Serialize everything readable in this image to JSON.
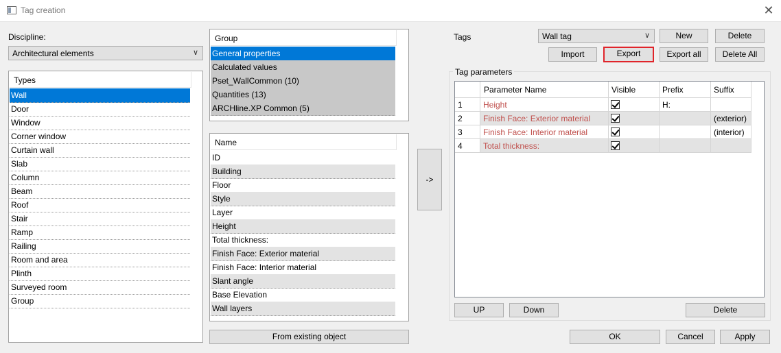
{
  "window": {
    "title": "Tag creation"
  },
  "discipline": {
    "label": "Discipline:",
    "value": "Architectural elements"
  },
  "types": {
    "header": "Types",
    "items": [
      "Wall",
      "Door",
      "Window",
      "Corner window",
      "Curtain wall",
      "Slab",
      "Column",
      "Beam",
      "Roof",
      "Stair",
      "Ramp",
      "Railing",
      "Room and area",
      "Plinth",
      "Surveyed room",
      "Group"
    ],
    "selected": 0
  },
  "groups": {
    "header": "Group",
    "items": [
      "General properties",
      "Calculated values",
      "Pset_WallCommon (10)",
      "Quantities (13)",
      "ARCHline.XP Common (5)"
    ],
    "selected": 0
  },
  "names": {
    "header": "Name",
    "items": [
      "ID",
      "Building",
      "Floor",
      "Style",
      "Layer",
      "Height",
      "Total thickness:",
      "Finish Face: Exterior material",
      "Finish Face: Interior material",
      "Slant angle",
      "Base Elevation",
      "Wall layers"
    ]
  },
  "from_existing_label": "From existing object",
  "transfer_label": "->",
  "tags": {
    "label": "Tags",
    "selected": "Wall tag",
    "buttons": {
      "new": "New",
      "delete": "Delete",
      "import": "Import",
      "export": "Export",
      "export_all": "Export all",
      "delete_all": "Delete All"
    }
  },
  "tag_parameters": {
    "title": "Tag parameters",
    "columns": [
      "",
      "Parameter Name",
      "Visible",
      "Prefix",
      "Suffix"
    ],
    "rows": [
      {
        "index": "1",
        "name": "Height",
        "visible": true,
        "prefix": "H:",
        "suffix": ""
      },
      {
        "index": "2",
        "name": "Finish Face: Exterior material",
        "visible": true,
        "prefix": "",
        "suffix": "(exterior)"
      },
      {
        "index": "3",
        "name": "Finish Face: Interior material",
        "visible": true,
        "prefix": "",
        "suffix": "(interior)"
      },
      {
        "index": "4",
        "name": "Total thickness:",
        "visible": true,
        "prefix": "",
        "suffix": ""
      }
    ],
    "buttons": {
      "up": "UP",
      "down": "Down",
      "delete": "Delete"
    }
  },
  "dialog_buttons": {
    "ok": "OK",
    "cancel": "Cancel",
    "apply": "Apply"
  },
  "colors": {
    "selection": "#0078d7",
    "export_border": "#e0242a",
    "param_name": "#c0504d"
  }
}
